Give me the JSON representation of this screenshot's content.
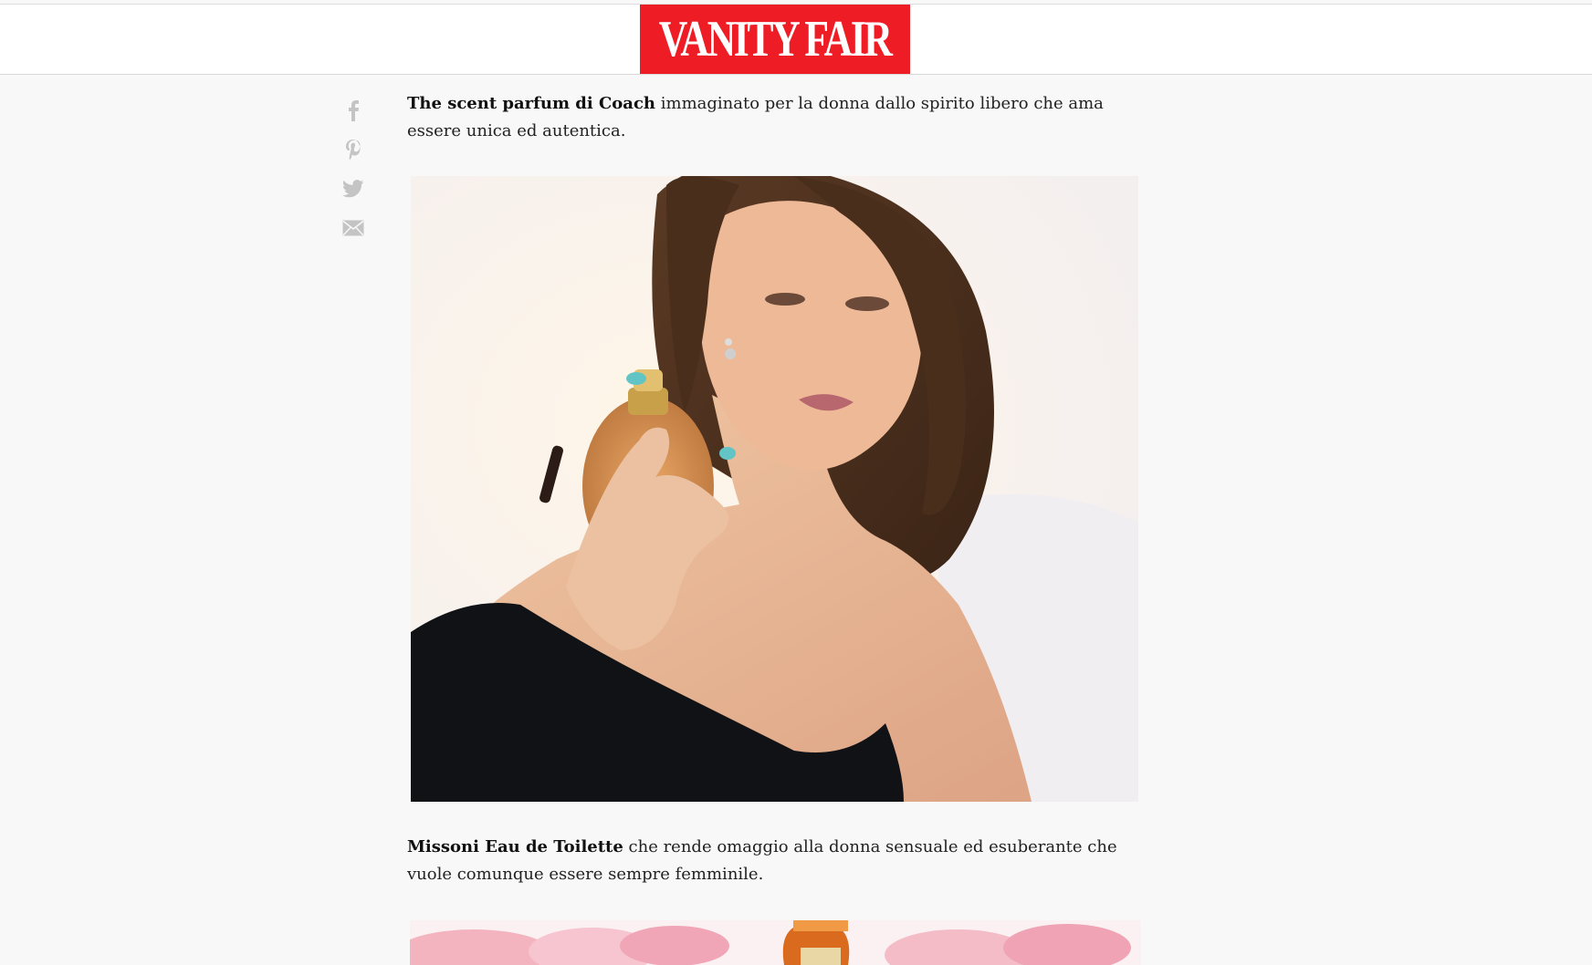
{
  "header": {
    "logo_text": "VANITY FAIR",
    "brand_color": "#ee1c25"
  },
  "share": {
    "items": [
      {
        "icon": "facebook-icon"
      },
      {
        "icon": "pinterest-icon"
      },
      {
        "icon": "twitter-icon"
      },
      {
        "icon": "email-icon"
      }
    ],
    "icon_color": "#bdbdbd"
  },
  "article": {
    "p1_bold": "The scent parfum di Coach",
    "p1_text": " immaginato per la donna dallo spirito libero che ama essere unica ed autentica.",
    "p2_bold": "Missoni Eau de Toilette",
    "p2_text": " che rende omaggio alla donna sensuale ed esuberante che vuole comunque essere sempre femminile."
  }
}
